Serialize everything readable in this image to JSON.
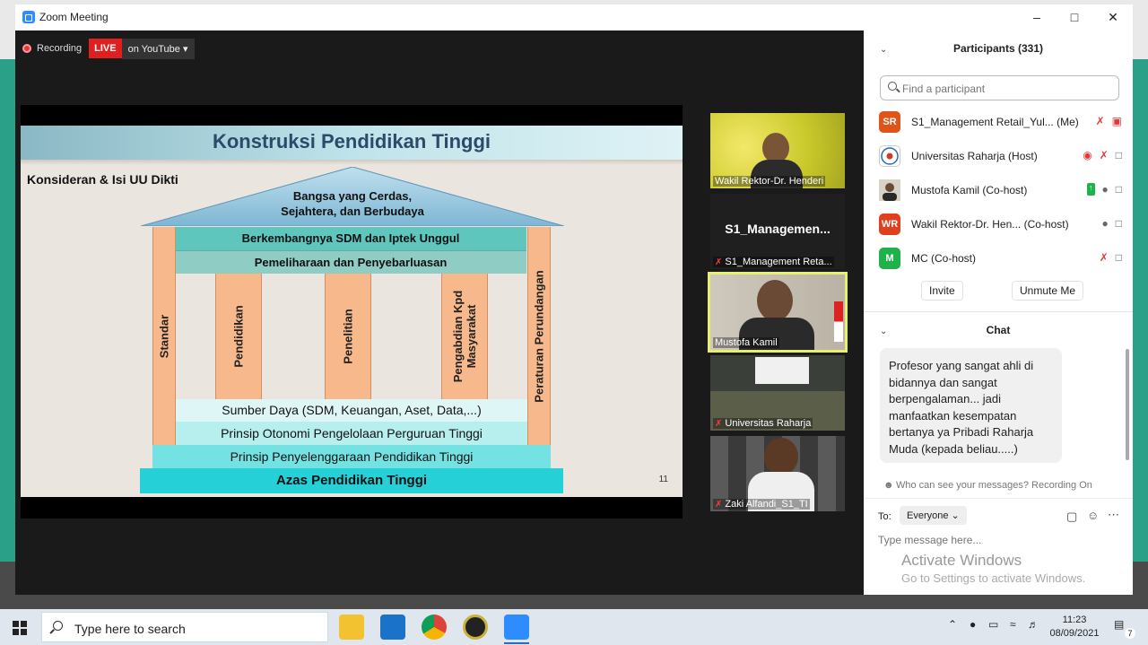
{
  "window": {
    "title": "Zoom Meeting"
  },
  "recording": {
    "label": "Recording",
    "live": "LIVE",
    "youtube": "on YouTube ▾"
  },
  "slide": {
    "title": "Konstruksi Pendidikan Tinggi",
    "subtitle": "Konsideran & Isi UU Dikti",
    "roof_line1": "Bangsa yang Cerdas,",
    "roof_line2": "Sejahtera, dan Berbudaya",
    "band_top": "Berkembangnya SDM dan Iptek Unggul",
    "band_second": "Pemeliharaan dan Penyebarluasan",
    "pillars": [
      "Standar",
      "Pendidikan",
      "Penelitian",
      "Pengabdian Kpd",
      "Masyarakat",
      "Peraturan Perundangan"
    ],
    "base1": "Sumber Daya (SDM, Keuangan, Aset, Data,...)",
    "base2": "Prinsip Otonomi Pengelolaan Perguruan Tinggi",
    "base3": "Prinsip Penyelenggaraan Pendidikan Tinggi",
    "base4": "Azas Pendidikan Tinggi",
    "page_num": "11"
  },
  "videos": [
    {
      "name": "Wakil Rektor-Dr. Henderi"
    },
    {
      "name": "S1_Managemen...",
      "footer": "S1_Management Reta..."
    },
    {
      "name": "Mustofa Kamil"
    },
    {
      "name": "Universitas Raharja"
    },
    {
      "name": "Zaki Alfandi_S1_TI"
    }
  ],
  "participants": {
    "header": "Participants (331)",
    "search_placeholder": "Find a participant",
    "list": [
      {
        "initials": "SR",
        "color": "#e0541c",
        "name": "S1_Management Retail_Yul...",
        "role": "(Me)"
      },
      {
        "initials": "",
        "color": "#ffffff",
        "name": "Universitas Raharja (Host)",
        "role": ""
      },
      {
        "initials": "",
        "color": "#3a3a3a",
        "name": "Mustofa Kamil (Co-host)",
        "role": ""
      },
      {
        "initials": "WR",
        "color": "#e0401c",
        "name": "Wakil Rektor-Dr. Hen...",
        "role": "(Co-host)"
      },
      {
        "initials": "M",
        "color": "#1fb14a",
        "name": "MC (Co-host)",
        "role": ""
      }
    ],
    "invite": "Invite",
    "unmute_me": "Unmute Me"
  },
  "chat": {
    "header": "Chat",
    "message": "Profesor yang sangat ahli di bidannya dan sangat berpengalaman... jadi manfaatkan kesempatan bertanya ya Pribadi Raharja Muda (kepada beliau.....)",
    "who_can_see": "Who can see your messages? Recording On",
    "to_label": "To:",
    "to_value": "Everyone ⌄",
    "input_placeholder": "Type message here...",
    "activate_title": "Activate Windows",
    "activate_sub": "Go to Settings to activate Windows."
  },
  "taskbar": {
    "search_text": "Type here to search",
    "time": "11:23",
    "date": "08/09/2021",
    "notif_count": "7"
  }
}
